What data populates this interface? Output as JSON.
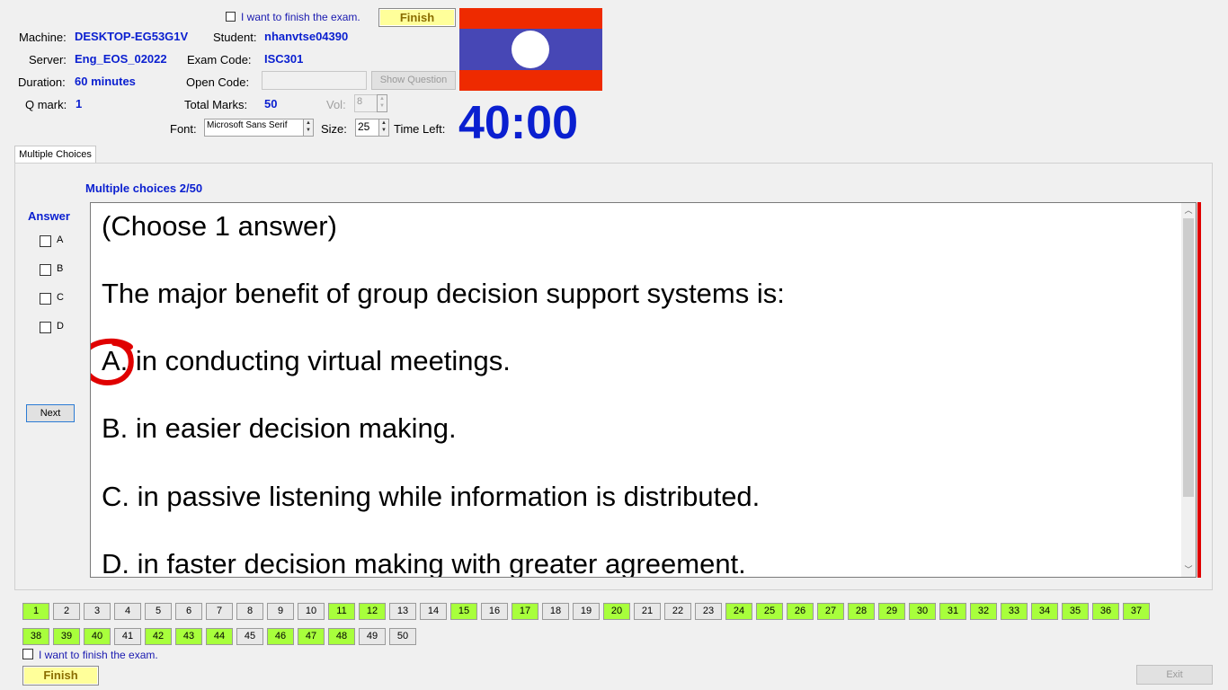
{
  "header": {
    "finish_check_label": "I want to finish the exam.",
    "finish_button": "Finish",
    "machine_label": "Machine:",
    "machine_value": "DESKTOP-EG53G1V",
    "student_label": "Student:",
    "student_value": "nhanvtse04390",
    "server_label": "Server:",
    "server_value": "Eng_EOS_02022",
    "exam_code_label": "Exam Code:",
    "exam_code_value": "ISC301",
    "duration_label": "Duration:",
    "duration_value": "60 minutes",
    "open_code_label": "Open Code:",
    "open_code_value": "",
    "show_question_button": "Show Question",
    "qmark_label": "Q mark:",
    "qmark_value": "1",
    "total_marks_label": "Total Marks:",
    "total_marks_value": "50",
    "vol_label": "Vol:",
    "vol_value": "8",
    "font_label": "Font:",
    "font_value": "Microsoft Sans Serif",
    "size_label": "Size:",
    "size_value": "25",
    "time_left_label": "Time Left:",
    "time_left_value": "40:00"
  },
  "tab": {
    "label": "Multiple Choices"
  },
  "question": {
    "counter": "Multiple choices 2/50",
    "instruction": "(Choose 1 answer)",
    "stem": "The major benefit of group decision support systems is:",
    "options": [
      "A.  in conducting virtual meetings.",
      "B.  in easier decision making.",
      "C.  in passive listening while information is distributed.",
      "D.  in faster decision making with greater agreement."
    ]
  },
  "answer_panel": {
    "title": "Answer",
    "choices": [
      "A",
      "B",
      "C",
      "D"
    ],
    "next_button": "Next"
  },
  "nav": {
    "questions": [
      {
        "n": "1",
        "done": true
      },
      {
        "n": "2",
        "done": false
      },
      {
        "n": "3",
        "done": false
      },
      {
        "n": "4",
        "done": false
      },
      {
        "n": "5",
        "done": false
      },
      {
        "n": "6",
        "done": false
      },
      {
        "n": "7",
        "done": false
      },
      {
        "n": "8",
        "done": false
      },
      {
        "n": "9",
        "done": false
      },
      {
        "n": "10",
        "done": false
      },
      {
        "n": "11",
        "done": true
      },
      {
        "n": "12",
        "done": true
      },
      {
        "n": "13",
        "done": false
      },
      {
        "n": "14",
        "done": false
      },
      {
        "n": "15",
        "done": true
      },
      {
        "n": "16",
        "done": false
      },
      {
        "n": "17",
        "done": true
      },
      {
        "n": "18",
        "done": false
      },
      {
        "n": "19",
        "done": false
      },
      {
        "n": "20",
        "done": true
      },
      {
        "n": "21",
        "done": false
      },
      {
        "n": "22",
        "done": false
      },
      {
        "n": "23",
        "done": false
      },
      {
        "n": "24",
        "done": true
      },
      {
        "n": "25",
        "done": true
      },
      {
        "n": "26",
        "done": true
      },
      {
        "n": "27",
        "done": true
      },
      {
        "n": "28",
        "done": true
      },
      {
        "n": "29",
        "done": true
      },
      {
        "n": "30",
        "done": true
      },
      {
        "n": "31",
        "done": true
      },
      {
        "n": "32",
        "done": true
      },
      {
        "n": "33",
        "done": true
      },
      {
        "n": "34",
        "done": true
      },
      {
        "n": "35",
        "done": true
      },
      {
        "n": "36",
        "done": true
      },
      {
        "n": "37",
        "done": true
      },
      {
        "n": "38",
        "done": true
      },
      {
        "n": "39",
        "done": true
      },
      {
        "n": "40",
        "done": true
      },
      {
        "n": "41",
        "done": false
      },
      {
        "n": "42",
        "done": true
      },
      {
        "n": "43",
        "done": true
      },
      {
        "n": "44",
        "done": true
      },
      {
        "n": "45",
        "done": false
      },
      {
        "n": "46",
        "done": true
      },
      {
        "n": "47",
        "done": true
      },
      {
        "n": "48",
        "done": true
      },
      {
        "n": "49",
        "done": false
      },
      {
        "n": "50",
        "done": false
      }
    ],
    "finish_check_label": "I want to finish the exam.",
    "finish_button": "Finish",
    "exit_button": "Exit"
  },
  "colors": {
    "done": "#a8ff3c",
    "accent_blue": "#0a1fd0",
    "flag_red": "#ee2a00",
    "flag_blue": "#4747b5"
  }
}
